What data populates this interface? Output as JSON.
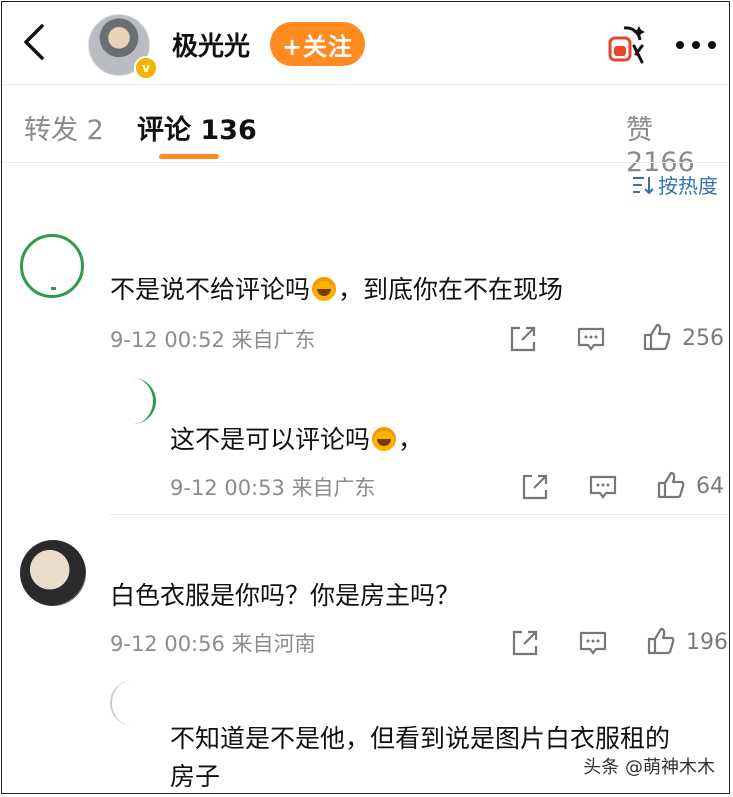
{
  "header": {
    "username": "极光光",
    "follow_label": "+关注",
    "verified_badge": "v",
    "icons": {
      "back": "back-arrow-icon",
      "ai": "ai-icon",
      "more": "more-icon"
    }
  },
  "tabs": {
    "repost": "转发 2",
    "comments": "评论 136",
    "likes": "赞 2166",
    "active_color": "#ff8a1f"
  },
  "sort": {
    "label": "按热度",
    "icon": "sort-icon"
  },
  "comments": [
    {
      "text_before": "不是说不给评论吗",
      "text_after": "，到底你在不在现场",
      "time": "9-12 00:52",
      "location": "来自广东",
      "likes": "256"
    },
    {
      "text_before": "这不是可以评论吗",
      "text_after": "，",
      "time": "9-12 00:53",
      "location": "来自广东",
      "likes": "64"
    },
    {
      "text_before": "白色衣服是你吗？你是房主吗？",
      "time": "9-12 00:56",
      "location": "来自河南",
      "likes": "196"
    },
    {
      "text_line1": "不知道是不是他，但看到说是图片白衣服租的",
      "text_line2": "房子"
    }
  ],
  "watermark": "头条 @萌神木木",
  "colors": {
    "accent": "#ff8a1f",
    "link": "#3a6fb0",
    "meta": "#8c8c8c"
  }
}
